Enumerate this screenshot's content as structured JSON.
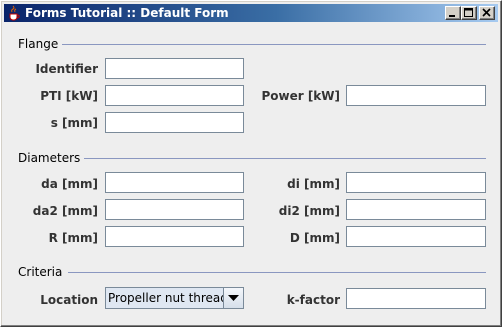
{
  "window": {
    "title": "Forms Tutorial :: Default Form"
  },
  "sections": {
    "flange": "Flange",
    "diameters": "Diameters",
    "criteria": "Criteria"
  },
  "flange": {
    "identifier_label": "Identifier",
    "identifier_value": "",
    "pti_label": "PTI [kW]",
    "pti_value": "",
    "power_label": "Power [kW]",
    "power_value": "",
    "s_label": "s [mm]",
    "s_value": ""
  },
  "diameters": {
    "da_label": "da [mm]",
    "da_value": "",
    "di_label": "di [mm]",
    "di_value": "",
    "da2_label": "da2 [mm]",
    "da2_value": "",
    "di2_label": "di2 [mm]",
    "di2_value": "",
    "r_label": "R [mm]",
    "r_value": "",
    "d_label": "D [mm]",
    "d_value": ""
  },
  "criteria": {
    "location_label": "Location",
    "location_selected": "Propeller nut thread",
    "kfactor_label": "k-factor",
    "kfactor_value": ""
  },
  "colors": {
    "title_gradient_start": "#0a246a",
    "title_gradient_end": "#a6caf0",
    "separator": "#8a97c0",
    "background": "#eeeeee"
  },
  "icons": {
    "app": "java-cup-icon",
    "minimize": "minimize-icon",
    "maximize": "maximize-icon",
    "close": "close-icon",
    "dropdown": "chevron-down-icon"
  }
}
